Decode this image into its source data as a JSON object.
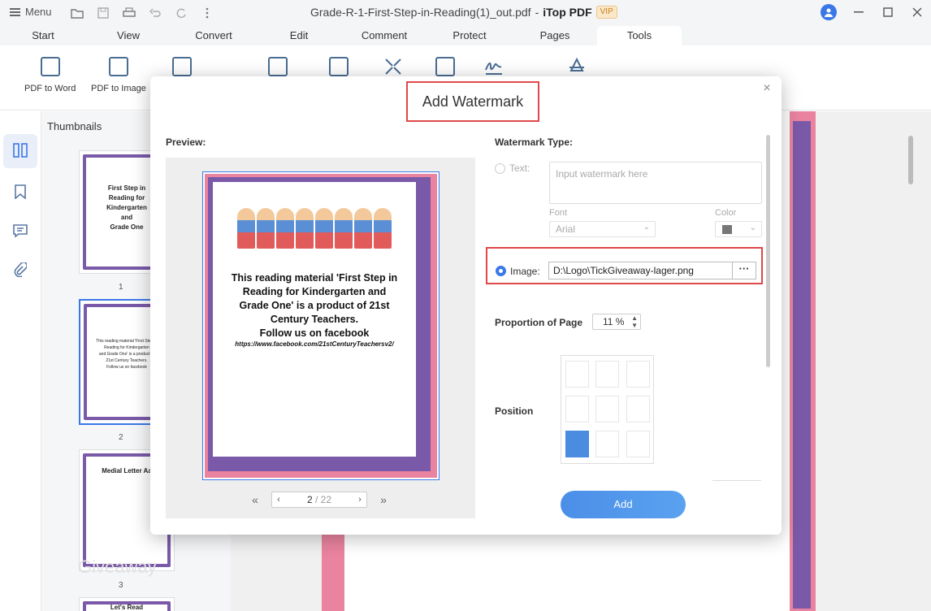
{
  "titlebar": {
    "menu_label": "Menu",
    "file_name": "Grade-R-1-First-Step-in-Reading(1)_out.pdf",
    "separator": "-",
    "app_name": "iTop PDF",
    "badge": "VIP"
  },
  "tabs": [
    "Start",
    "View",
    "Convert",
    "Edit",
    "Comment",
    "Protect",
    "Pages",
    "Tools"
  ],
  "ribbon": {
    "pdf_to_word": "PDF to Word",
    "pdf_to_image": "PDF to Image"
  },
  "thumbnails": {
    "title": "Thumbnails",
    "pages": [
      {
        "number": "1",
        "lines": [
          "First Step in",
          "Reading for",
          "Kindergarten",
          "and",
          "Grade One"
        ]
      },
      {
        "number": "2",
        "lines": [
          "This reading material 'First Step in",
          "Reading for Kindergarten",
          "and Grade One' is a product of",
          "21st Century Teachers.",
          "Follow us on facebook"
        ]
      },
      {
        "number": "3",
        "lines": [
          "Medial Letter Aa"
        ]
      },
      {
        "number": "",
        "lines": [
          "Let's Read"
        ]
      }
    ]
  },
  "watermark_text": "Giveaway",
  "dialog": {
    "title": "Add Watermark",
    "preview_label": "Preview:",
    "preview_lines": [
      "This reading material 'First Step in",
      "Reading for Kindergarten and",
      "Grade One' is a product of 21st",
      "Century Teachers.",
      "Follow us on facebook"
    ],
    "preview_url": "https://www.facebook.com/21stCenturyTeachersv2/",
    "pager": {
      "current": "2",
      "total": "/ 22"
    },
    "type_label": "Watermark Type:",
    "text_option": "Text:",
    "text_placeholder": "Input watermark here",
    "font_label": "Font",
    "font_value": "Arial",
    "color_label": "Color",
    "image_option": "Image:",
    "image_path": "D:\\Logo\\TickGiveaway-lager.png",
    "proportion_label": "Proportion of Page",
    "proportion_value": "11 %",
    "position_label": "Position",
    "position_selected": "bottom-left",
    "add_button": "Add"
  }
}
